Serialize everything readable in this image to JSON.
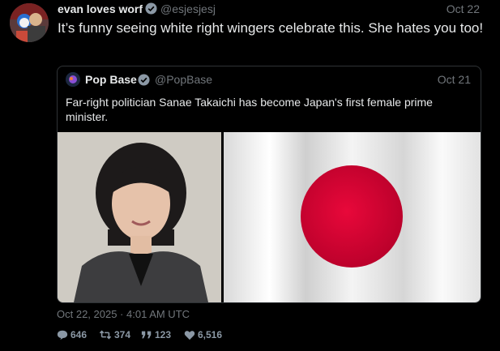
{
  "tweet": {
    "name": "evan loves worf",
    "handle": "@esjesjesj",
    "date": "Oct 22",
    "text": "It’s funny seeing white right wingers celebrate this. She hates you too!",
    "timestamp": "Oct 22, 2025 · 4:01 AM UTC",
    "stats": {
      "replies": "646",
      "retweets": "374",
      "quotes": "123",
      "likes": "6,516"
    }
  },
  "quote": {
    "name": "Pop Base",
    "handle": "@PopBase",
    "date": "Oct 21",
    "text": "Far-right politician Sanae Takaichi has become Japan's first female prime minister."
  },
  "icons": {
    "verified": "verified-badge-icon",
    "reply": "reply-icon",
    "retweet": "retweet-icon",
    "quote": "quote-icon",
    "like": "heart-icon"
  },
  "colors": {
    "background": "#000000",
    "text": "#e7e9ea",
    "muted": "#71767b",
    "flag_red": "#d4002f"
  }
}
